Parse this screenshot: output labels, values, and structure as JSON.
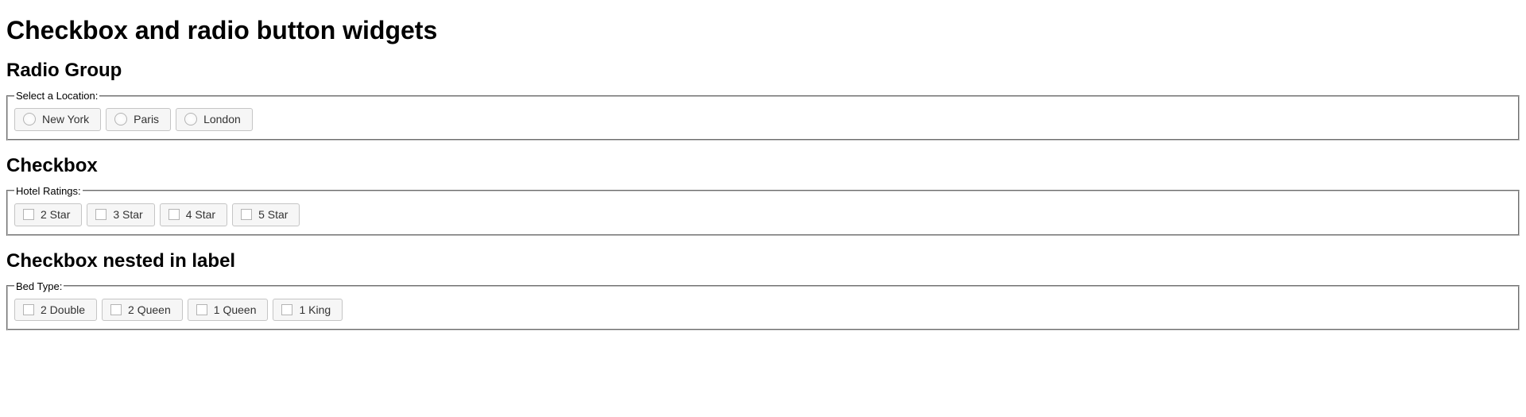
{
  "page_title": "Checkbox and radio button widgets",
  "sections": {
    "radio": {
      "heading": "Radio Group",
      "legend": "Select a Location:",
      "options": [
        {
          "label": "New York"
        },
        {
          "label": "Paris"
        },
        {
          "label": "London"
        }
      ]
    },
    "checkbox": {
      "heading": "Checkbox",
      "legend": "Hotel Ratings:",
      "options": [
        {
          "label": "2 Star"
        },
        {
          "label": "3 Star"
        },
        {
          "label": "4 Star"
        },
        {
          "label": "5 Star"
        }
      ]
    },
    "nested": {
      "heading": "Checkbox nested in label",
      "legend": "Bed Type:",
      "options": [
        {
          "label": "2 Double"
        },
        {
          "label": "2 Queen"
        },
        {
          "label": "1 Queen"
        },
        {
          "label": "1 King"
        }
      ]
    }
  }
}
